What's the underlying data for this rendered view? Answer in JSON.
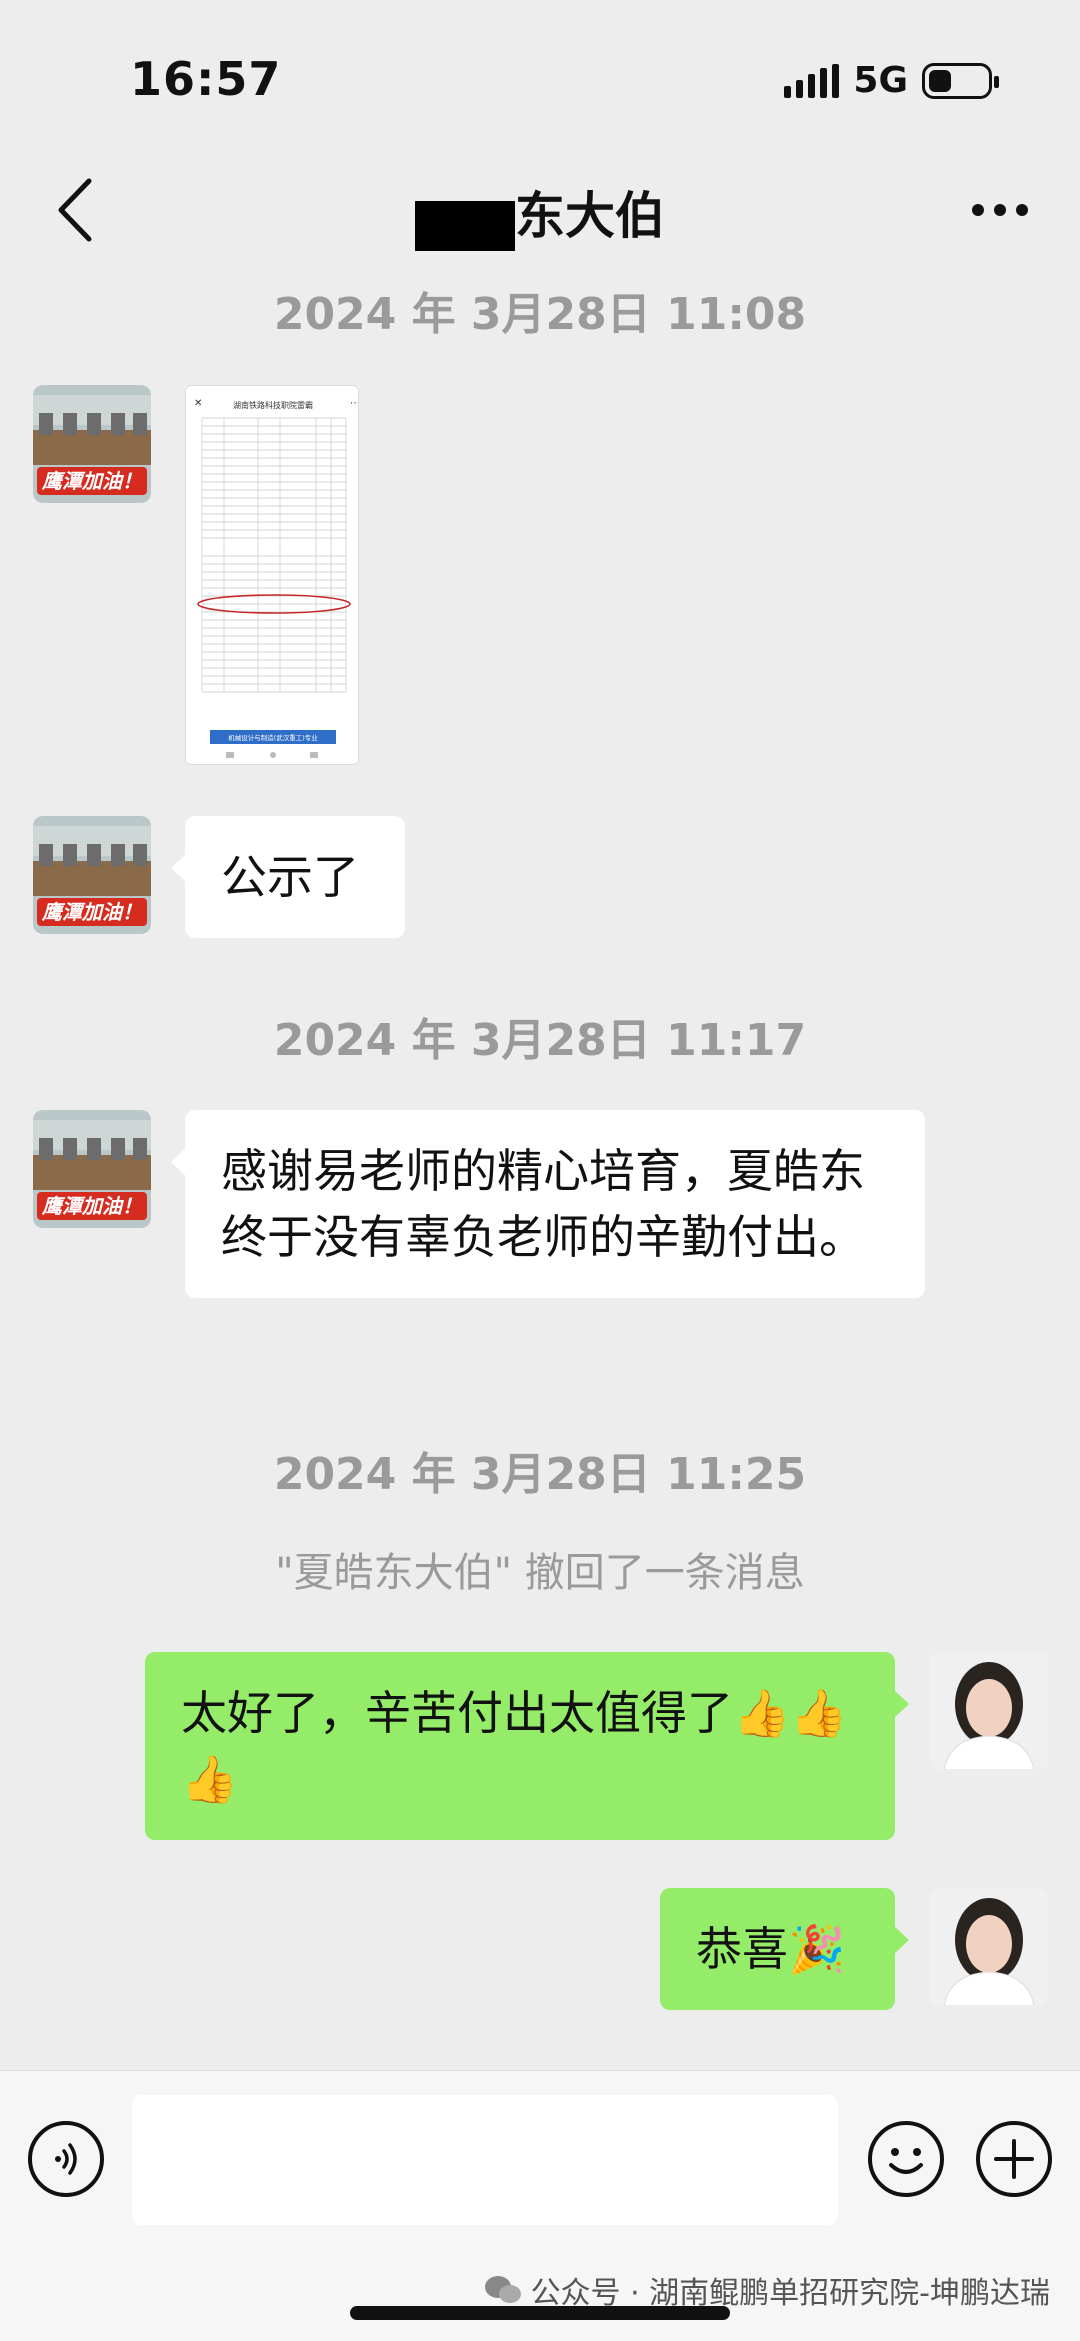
{
  "status_bar": {
    "time": "16:57",
    "network": "5G"
  },
  "nav": {
    "title": "东大伯"
  },
  "messages": {
    "time1": "2024 年 3月28日 11:08",
    "image_caption": "湖南铁路科技职院雷霸",
    "image_banner": "机械设计与制造(武汉重工)专业",
    "avatar_text": "鹰潭加油！",
    "text1": "公示了",
    "time2": "2024 年 3月28日 11:17",
    "text2": "感谢易老师的精心培育，夏皓东终于没有辜负老师的辛勤付出。",
    "time3": "2024 年 3月28日 11:25",
    "recall_notice": "\"夏皓东大伯\" 撤回了一条消息",
    "reply1": "太好了，辛苦付出太值得了👍👍👍",
    "reply2": "恭喜🎉"
  },
  "footer": {
    "watermark": "公众号 · 湖南鲲鹏单招研究院-坤鹏达瑞"
  },
  "colors": {
    "background": "#ededed",
    "own_bubble": "#95ec69",
    "other_bubble": "#ffffff"
  }
}
